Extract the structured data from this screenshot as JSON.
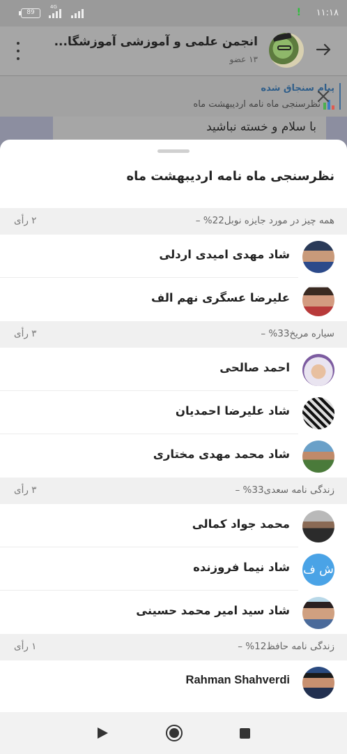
{
  "status_bar": {
    "time": "۱۱:۱۸",
    "battery": "89",
    "network": "4G"
  },
  "header": {
    "title": "انجمن علمی و آموزشی آموزشگا...",
    "subtitle": "۱۳ عضو"
  },
  "pinned": {
    "title": "پیام سنجاق شده",
    "text": "نظرسنجی ماه نامه اردیبهشت ماه"
  },
  "chat": {
    "bubble_text": "با سلام و خسته نباشید"
  },
  "sheet": {
    "title": "نظرسنجی ماه نامه اردیبهشت ماه",
    "sections": [
      {
        "title": "همه چیز در مورد جایزه نوبل22% –",
        "votes": "۲ رأی",
        "voters": [
          "شاد مهدی امیدی اردلی",
          "علیرضا عسگری نهم الف"
        ]
      },
      {
        "title": "سیاره مریخ33% –",
        "votes": "۳ رأی",
        "voters": [
          "احمد صالحی",
          "شاد علیرضا احمدیان",
          "شاد محمد مهدی مختاری"
        ]
      },
      {
        "title": "زندگی نامه سعدی33% –",
        "votes": "۳ رأی",
        "voters": [
          "محمد جواد کمالی",
          "شاد نیما فروزنده",
          "شاد سید امیر محمد حسینی"
        ]
      },
      {
        "title": "زندگی نامه حافظ12% –",
        "votes": "۱ رأی",
        "voters": [
          "Rahman Shahverdi"
        ]
      }
    ],
    "initials": "ش ف"
  },
  "colors": {
    "accent": "#2f5e8a",
    "avatar_blue": "#4aa3e6"
  }
}
